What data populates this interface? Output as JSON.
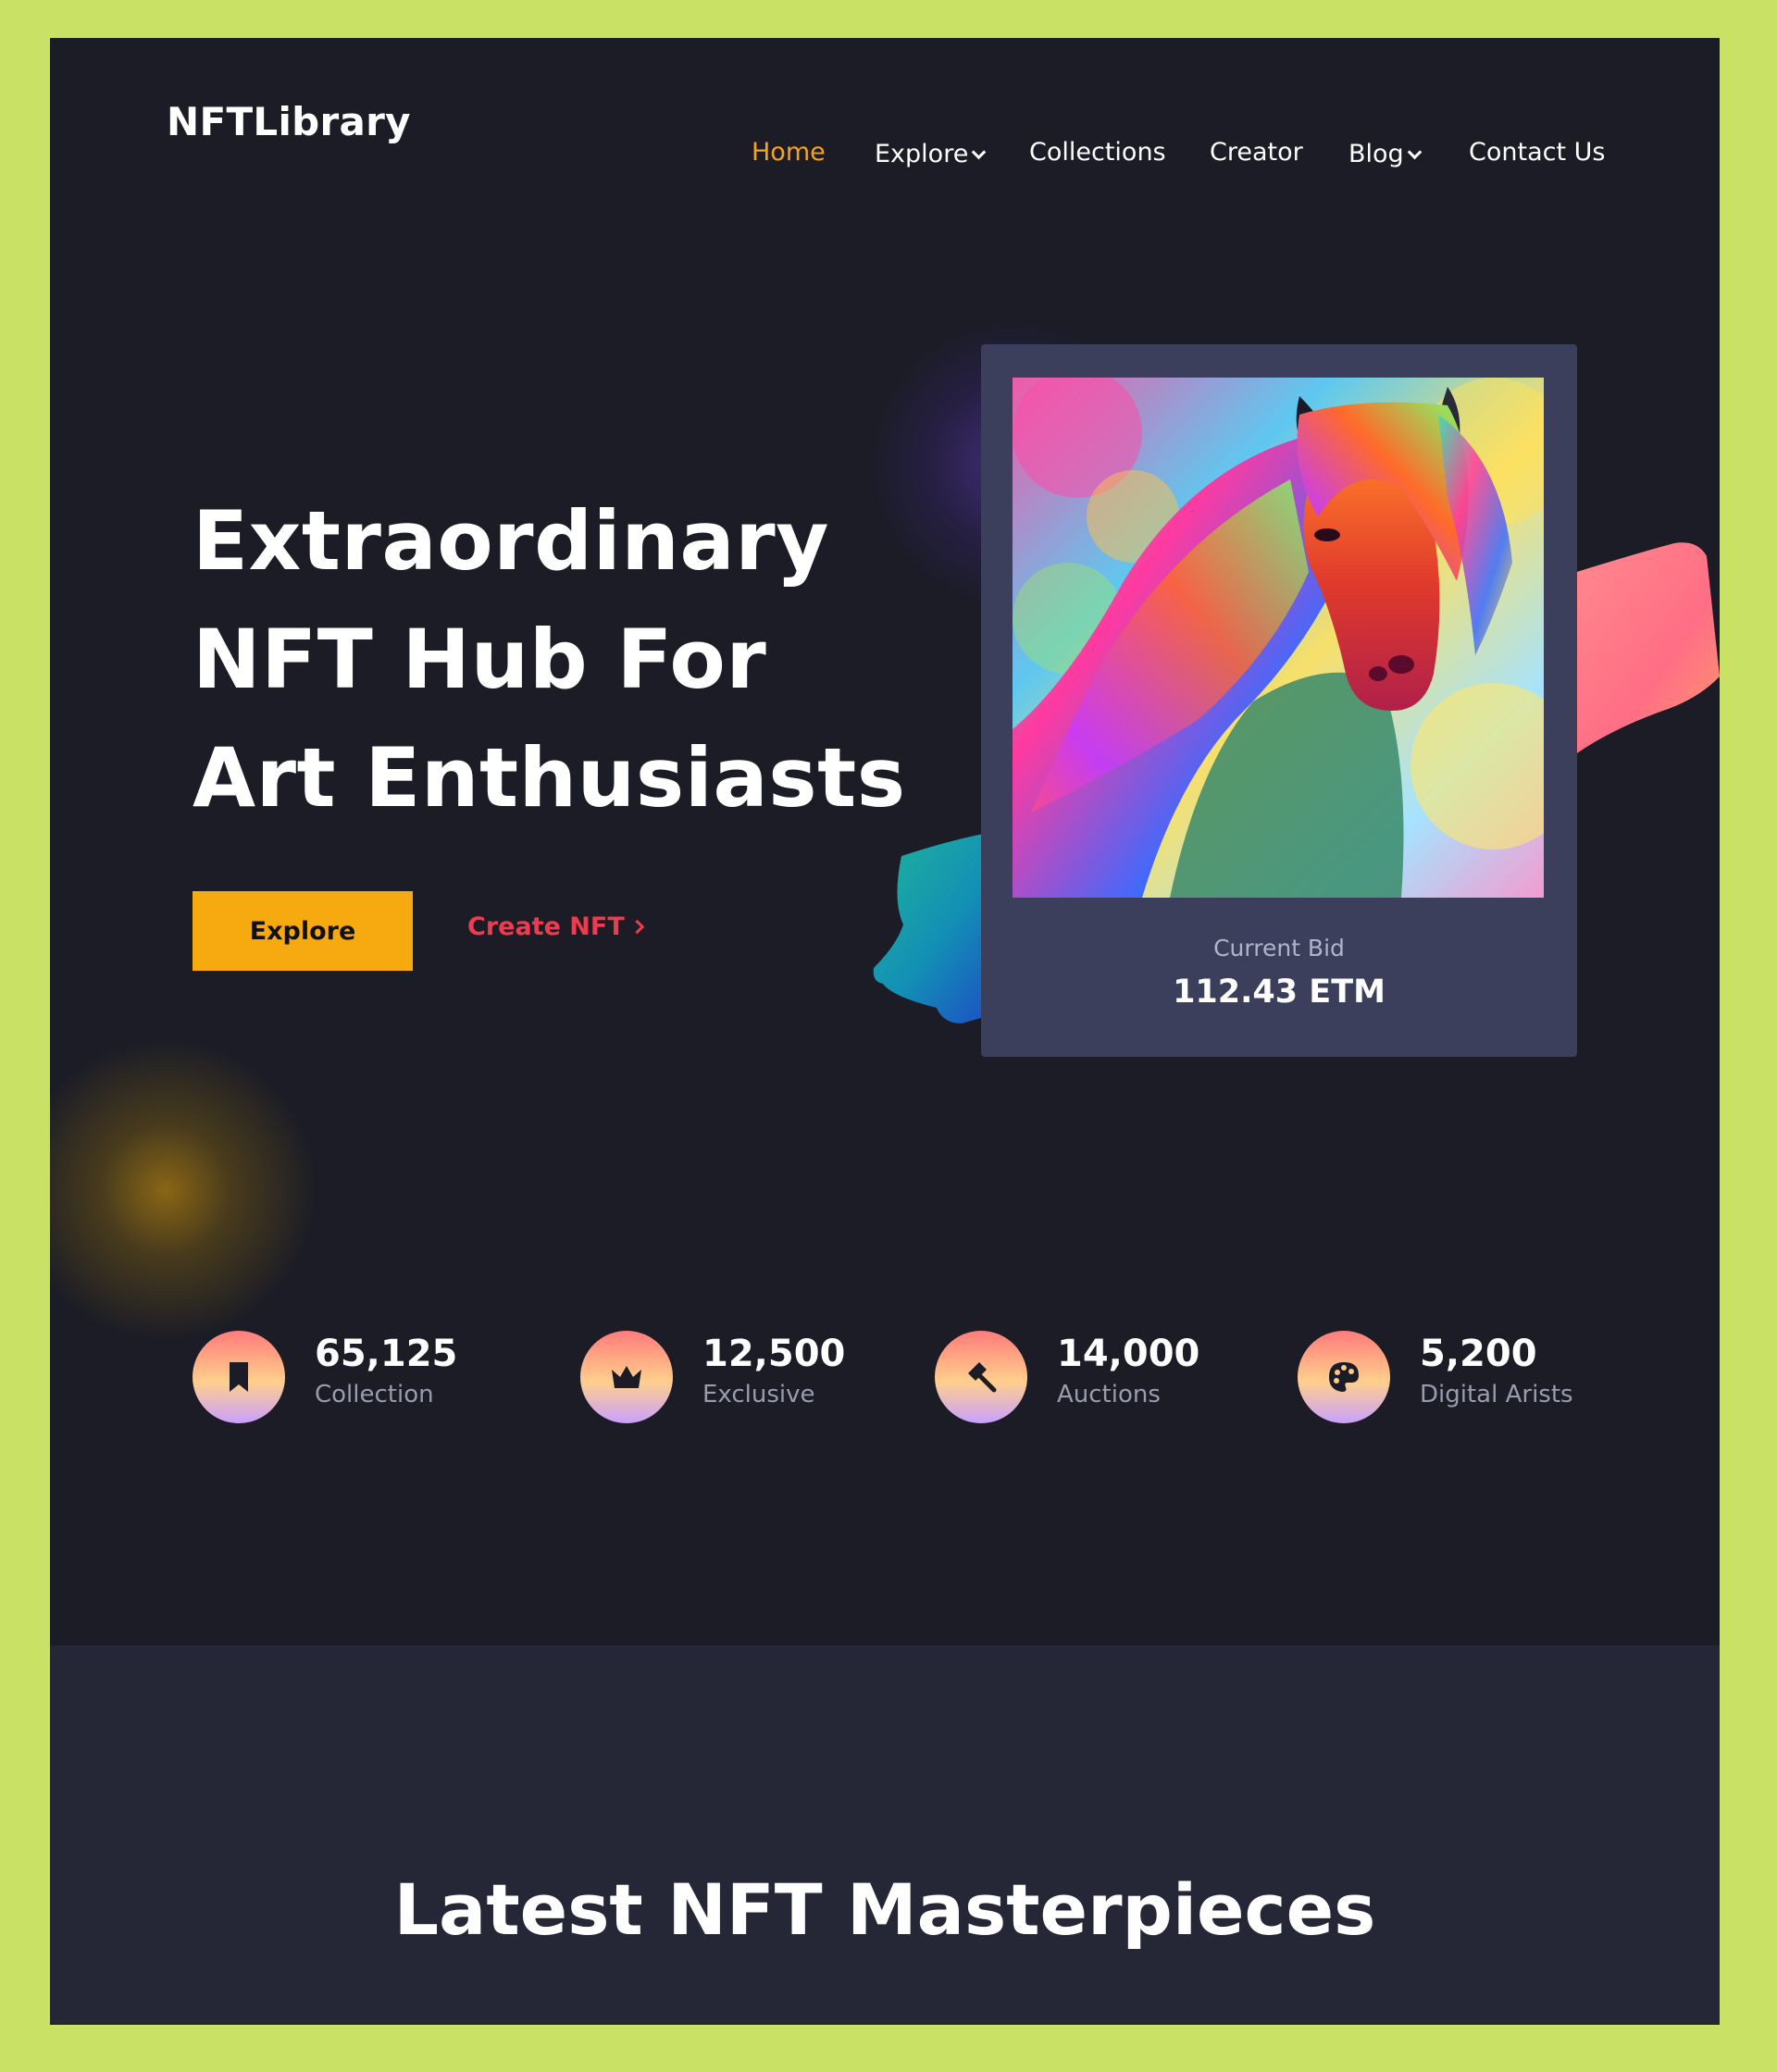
{
  "header": {
    "logo": "NFTLibrary",
    "nav": [
      {
        "label": "Home",
        "active": true
      },
      {
        "label": "Explore",
        "dropdown": true
      },
      {
        "label": "Collections"
      },
      {
        "label": "Creator"
      },
      {
        "label": "Blog",
        "dropdown": true
      },
      {
        "label": "Contact Us"
      }
    ]
  },
  "hero": {
    "title_lines": [
      "Extraordinary",
      "NFT Hub For",
      "Art Enthusiasts"
    ],
    "explore_button": "Explore",
    "create_link": "Create NFT"
  },
  "nft_card": {
    "bid_label": "Current Bid",
    "bid_value": "112.43 ETM"
  },
  "stats": [
    {
      "value": "65,125",
      "label": "Collection",
      "icon": "bookmark-icon"
    },
    {
      "value": "12,500",
      "label": "Exclusive",
      "icon": "crown-icon"
    },
    {
      "value": "14,000",
      "label": "Auctions",
      "icon": "gavel-icon"
    },
    {
      "value": "5,200",
      "label": "Digital Arists",
      "icon": "palette-icon"
    }
  ],
  "latest": {
    "title": "Latest NFT Masterpieces"
  },
  "colors": {
    "outer_background": "#c9e265",
    "page_background": "#1b1c26",
    "accent_orange": "#f7a910",
    "accent_red": "#ef3b4f",
    "card_background": "#3b3f5c",
    "lower_section_background": "#252736"
  }
}
